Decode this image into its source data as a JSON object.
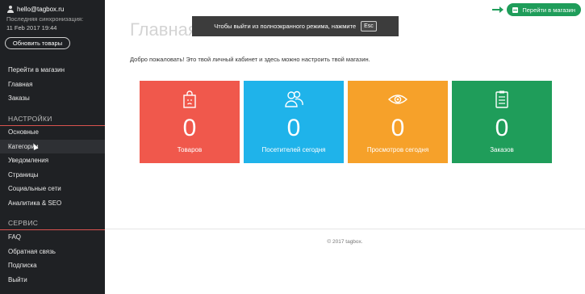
{
  "user": {
    "email": "hello@tagbox.ru",
    "sync_label": "Последняя синхронизация:",
    "sync_time": "11 Feb 2017 19:44"
  },
  "sidebar": {
    "update_button": "Обновить товары",
    "top_items": [
      {
        "label": "Перейти в магазин"
      },
      {
        "label": "Главная"
      },
      {
        "label": "Заказы"
      }
    ],
    "settings_title": "НАСТРОЙКИ",
    "settings_items": [
      {
        "label": "Основные"
      },
      {
        "label": "Категории"
      },
      {
        "label": "Уведомления"
      },
      {
        "label": "Страницы"
      },
      {
        "label": "Социальные сети"
      },
      {
        "label": "Аналитика & SEO"
      }
    ],
    "service_title": "СЕРВИС",
    "service_items": [
      {
        "label": "FAQ"
      },
      {
        "label": "Обратная связь"
      },
      {
        "label": "Подписка"
      },
      {
        "label": "Выйти"
      }
    ]
  },
  "main": {
    "title": "Главная",
    "welcome": "Добро пожаловать! Это твой личный кабинет и здесь можно настроить твой магазин.",
    "go_shop_button": "Перейти в магазин",
    "tiles": [
      {
        "value": "0",
        "label": "Товаров",
        "icon": "shopping-bag-icon",
        "color": "#f0584c"
      },
      {
        "value": "0",
        "label": "Посетителей сегодня",
        "icon": "users-icon",
        "color": "#1fb3ea"
      },
      {
        "value": "0",
        "label": "Просмотров сегодня",
        "icon": "eye-icon",
        "color": "#f6a12a"
      },
      {
        "value": "0",
        "label": "Заказов",
        "icon": "clipboard-icon",
        "color": "#1f9d5a"
      }
    ],
    "footer": "© 2017 tagbox."
  },
  "toast": {
    "text": "Чтобы выйти из полноэкранного режима, нажмите",
    "key": "Esc"
  },
  "colors": {
    "sidebar_bg": "#1f2124",
    "accent_line": "#d9534f",
    "brand_green": "#1f9d5a"
  }
}
